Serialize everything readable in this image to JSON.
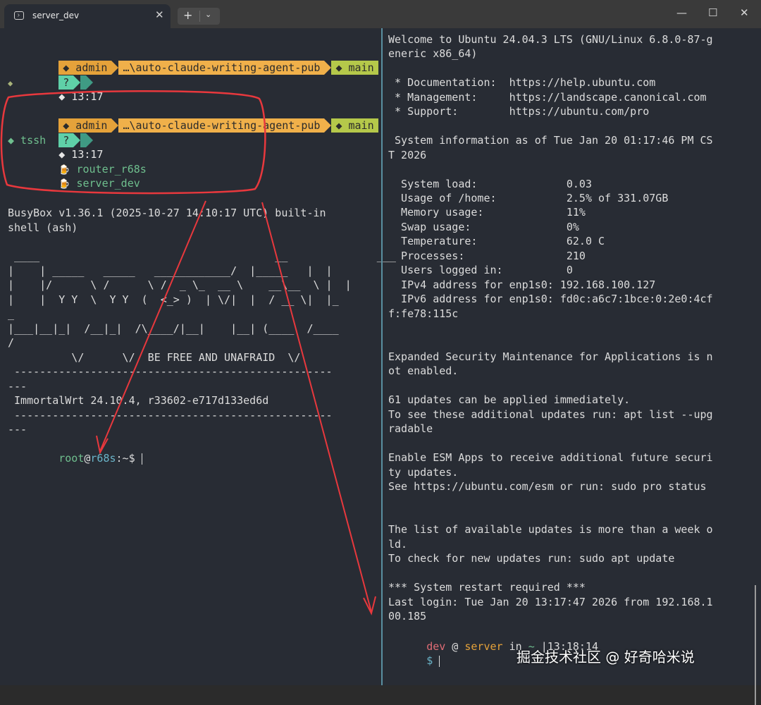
{
  "window": {
    "tab_title": "server_dev",
    "tab_close": "✕",
    "new_tab": "+",
    "new_tab_menu": "⌄",
    "minimize": "—",
    "maximize": "☐",
    "close": "✕"
  },
  "left": {
    "prompt1": {
      "user": "◆ admin",
      "path": "…\\auto-claude-writing-agent-pub",
      "git": "◆ main",
      "status": "?",
      "time": "◆ 13:17",
      "caret": "◆"
    },
    "prompt2": {
      "user": "◆ admin",
      "path": "…\\auto-claude-writing-agent-pub",
      "git": "◆ main",
      "status": "?",
      "time": "◆ 13:17",
      "cmd": "◆ tssh"
    },
    "hosts": [
      {
        "icon": "🍺",
        "name": "router_r68s"
      },
      {
        "icon": "🍺",
        "name": "server_dev"
      }
    ],
    "busybox": [
      "BusyBox v1.36.1 (2025-10-27 14:10:17 UTC) built-in",
      "shell (ash)"
    ],
    "ascii": [
      " ____                                     __              ___",
      "|    | _____   _____   ____________/  |_____   |  |",
      "|    |/      \\ /      \\ /  _ \\_  __ \\    __\\__  \\ |  |",
      "|    |  Y Y  \\  Y Y  (  <_> )  | \\/|  |  / __ \\|  |_",
      "_",
      "|___|__|_|  /__|_|  /\\____/|__|    |__| (____  /____",
      "/",
      "          \\/      \\/  BE FREE AND UNAFRAID  \\/",
      " --------------------------------------------------",
      "---",
      " ImmortalWrt 24.10.4, r33602-e717d133ed6d",
      " --------------------------------------------------",
      "---"
    ],
    "shell_prompt": {
      "user": "root",
      "at": "@",
      "host": "r68s",
      "rest": ":~$ "
    }
  },
  "right": {
    "lines": [
      "Welcome to Ubuntu 24.04.3 LTS (GNU/Linux 6.8.0-87-g",
      "eneric x86_64)",
      "",
      " * Documentation:  https://help.ubuntu.com",
      " * Management:     https://landscape.canonical.com",
      " * Support:        https://ubuntu.com/pro",
      "",
      " System information as of Tue Jan 20 01:17:46 PM CS",
      "T 2026",
      "",
      "  System load:              0.03",
      "  Usage of /home:           2.5% of 331.07GB",
      "  Memory usage:             11%",
      "  Swap usage:               0%",
      "  Temperature:              62.0 C",
      "  Processes:                210",
      "  Users logged in:          0",
      "  IPv4 address for enp1s0: 192.168.100.127",
      "  IPv6 address for enp1s0: fd0c:a6c7:1bce:0:2e0:4cf",
      "f:fe78:115c",
      "",
      "",
      "Expanded Security Maintenance for Applications is n",
      "ot enabled.",
      "",
      "61 updates can be applied immediately.",
      "To see these additional updates run: apt list --upg",
      "radable",
      "",
      "Enable ESM Apps to receive additional future securi",
      "ty updates.",
      "See https://ubuntu.com/esm or run: sudo pro status",
      "",
      "",
      "The list of available updates is more than a week o",
      "ld.",
      "To check for new updates run: sudo apt update",
      "",
      "*** System restart required ***",
      "Last login: Tue Jan 20 13:17:47 2026 from 192.168.1",
      "00.185"
    ],
    "prompt": {
      "user": "dev",
      "at": " @ ",
      "host": "server",
      "in": " in ",
      "dir": "~",
      "time": " |13:18:14",
      "dollar": "$ "
    }
  },
  "watermark": "掘金技术社区 @ 好奇哈米说",
  "colors": {
    "annotation": "#e8383d",
    "background": "#282c34",
    "divider": "#5a8fa0"
  }
}
